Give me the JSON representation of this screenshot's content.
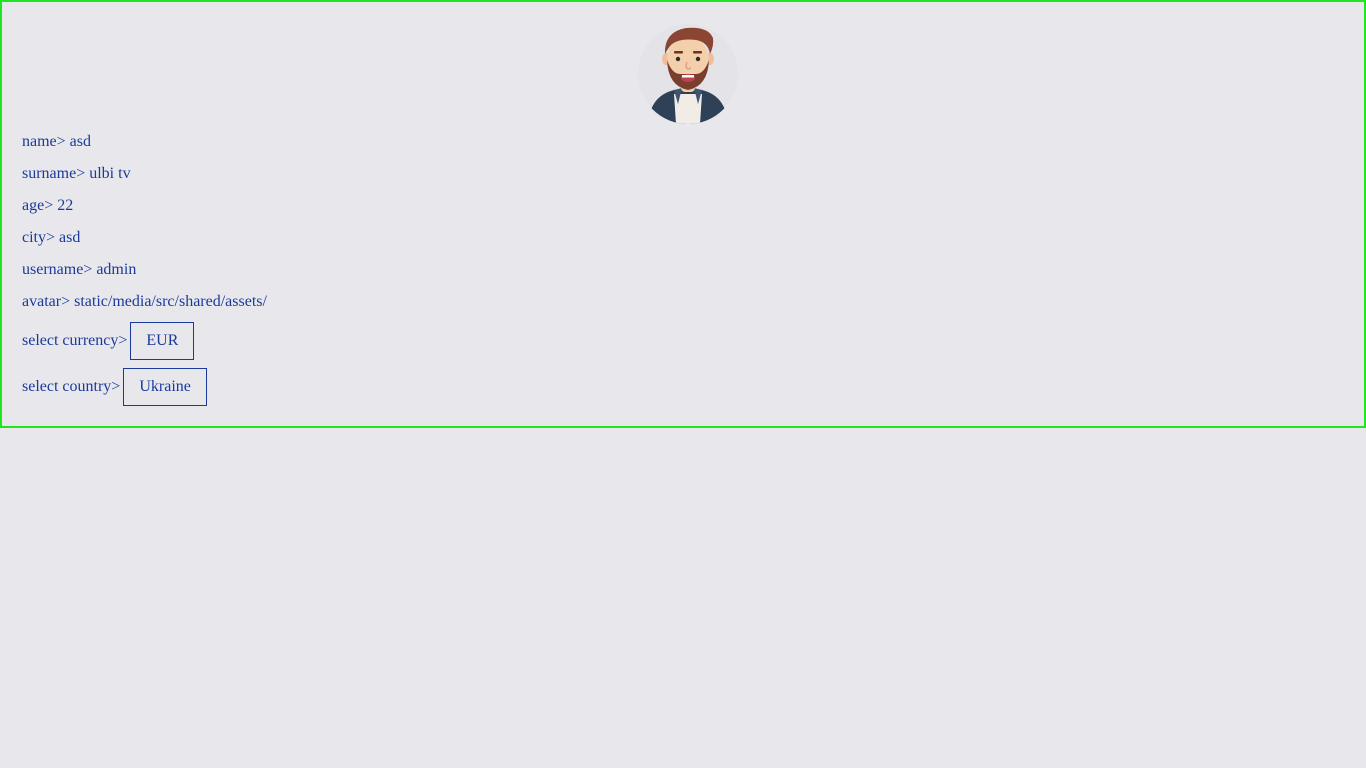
{
  "profile": {
    "avatar_icon": "bearded-man-avatar",
    "fields": [
      {
        "label": "name>",
        "value": "asd"
      },
      {
        "label": "surname>",
        "value": "ulbi tv"
      },
      {
        "label": "age>",
        "value": "22"
      },
      {
        "label": "city>",
        "value": "asd"
      },
      {
        "label": "username>",
        "value": "admin"
      },
      {
        "label": "avatar>",
        "value": "static/media/src/shared/assets/"
      }
    ],
    "currency": {
      "label": "select currency>",
      "value": "EUR"
    },
    "country": {
      "label": "select country>",
      "value": "Ukraine"
    }
  },
  "colors": {
    "text": "#1a3a9a",
    "border": "#1ee61e",
    "background": "#e8e8ec"
  }
}
